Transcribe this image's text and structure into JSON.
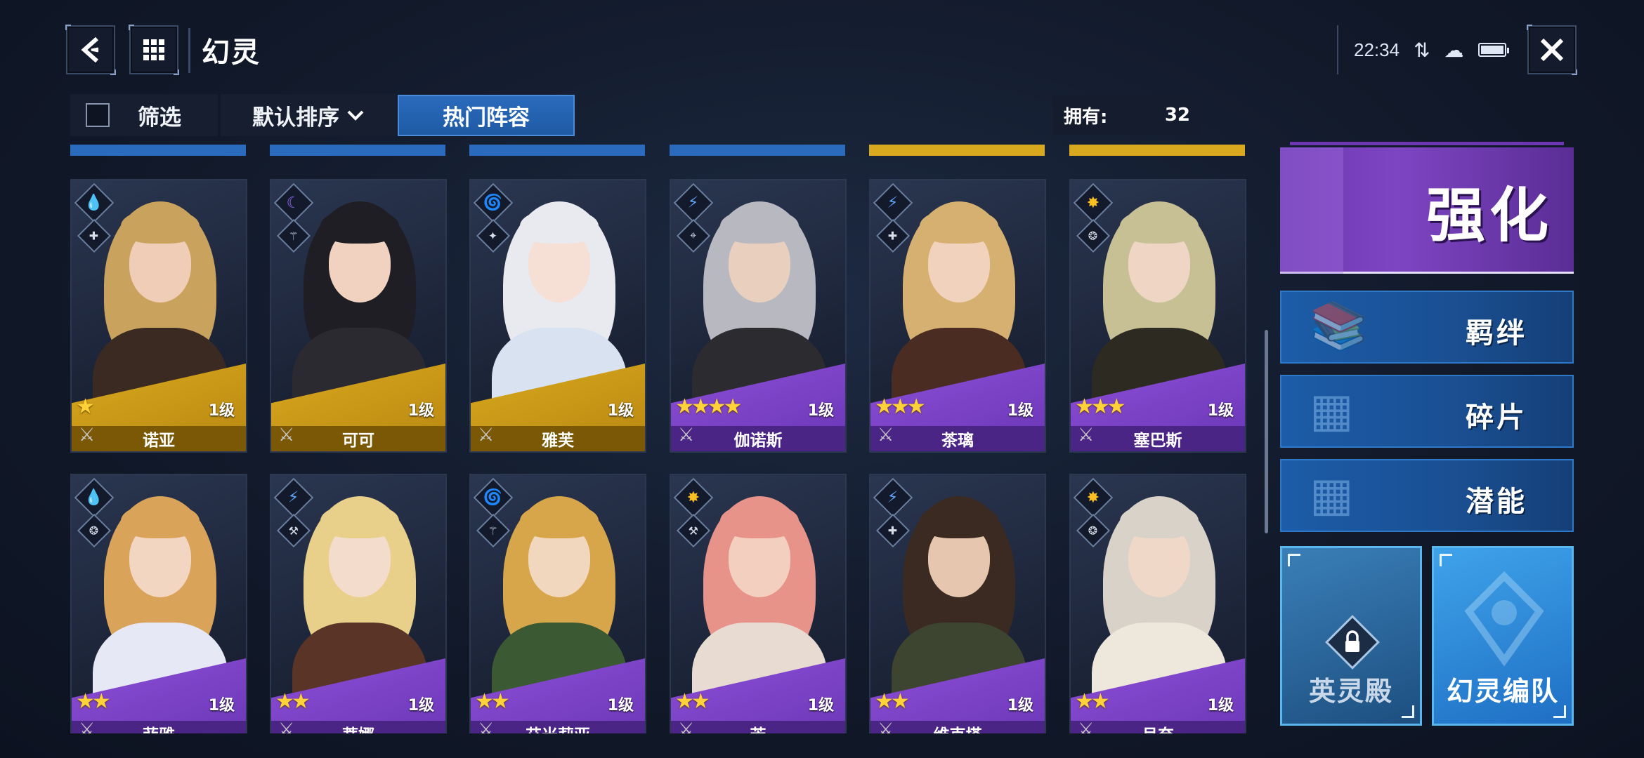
{
  "header": {
    "back_icon": "back-arrow-icon",
    "menu_icon": "grid-menu-icon",
    "title": "幻灵",
    "close_icon": "close-icon"
  },
  "status_bar": {
    "time": "22:34",
    "icons": [
      "data-transfer-icon",
      "weather-icon",
      "battery-icon"
    ]
  },
  "filter_bar": {
    "filter_label": "筛选",
    "filter_checked": false,
    "sort_label": "默认排序",
    "hot_label": "热门阵容",
    "owned_label": "拥有:",
    "owned_count": "32"
  },
  "rarity_colors": {
    "gold": "#d8a81e",
    "purple": "#7e45c2",
    "blue": "#2a6bbd"
  },
  "top_strip_colors": [
    "#2a6bbd",
    "#2a6bbd",
    "#2a6bbd",
    "#2a6bbd",
    "#d8a81e",
    "#d8a81e"
  ],
  "cards": [
    {
      "name": "诺亚",
      "level": "1级",
      "stars": 1,
      "rarity": "gold",
      "element": "water",
      "element_glyph": "💧",
      "element_color": "#4fc3f7",
      "role_glyph": "✚",
      "weapon_glyph": "⚔"
    },
    {
      "name": "可可",
      "level": "1级",
      "stars": 0,
      "rarity": "gold",
      "element": "moon",
      "element_glyph": "☾",
      "element_color": "#9b6bff",
      "role_glyph": "⚚",
      "weapon_glyph": "⚔"
    },
    {
      "name": "雅芙",
      "level": "1级",
      "stars": 0,
      "rarity": "gold",
      "element": "wind",
      "element_glyph": "🌀",
      "element_color": "#4ade80",
      "role_glyph": "✦",
      "weapon_glyph": "⚔"
    },
    {
      "name": "伽诺斯",
      "level": "1级",
      "stars": 4,
      "rarity": "purple",
      "element": "thunder",
      "element_glyph": "⚡",
      "element_color": "#60a5fa",
      "role_glyph": "⌖",
      "weapon_glyph": "⚔"
    },
    {
      "name": "茶璃",
      "level": "1级",
      "stars": 3,
      "rarity": "purple",
      "element": "thunder",
      "element_glyph": "⚡",
      "element_color": "#60a5fa",
      "role_glyph": "✚",
      "weapon_glyph": "⚔"
    },
    {
      "name": "塞巴斯",
      "level": "1级",
      "stars": 3,
      "rarity": "purple",
      "element": "light",
      "element_glyph": "✸",
      "element_color": "#fbbf24",
      "role_glyph": "❂",
      "weapon_glyph": "⚔"
    },
    {
      "name": "菲雅",
      "level": "1级",
      "stars": 2,
      "rarity": "purple",
      "element": "water",
      "element_glyph": "💧",
      "element_color": "#4fc3f7",
      "role_glyph": "❂",
      "weapon_glyph": "⚔"
    },
    {
      "name": "蒂娜",
      "level": "1级",
      "stars": 2,
      "rarity": "purple",
      "element": "thunder",
      "element_glyph": "⚡",
      "element_color": "#60a5fa",
      "role_glyph": "⚒",
      "weapon_glyph": "⚔"
    },
    {
      "name": "艾米莉亚",
      "level": "1级",
      "stars": 2,
      "rarity": "purple",
      "element": "wind",
      "element_glyph": "🌀",
      "element_color": "#4ade80",
      "role_glyph": "⚚",
      "weapon_glyph": "⚔"
    },
    {
      "name": "芳",
      "level": "1级",
      "stars": 2,
      "rarity": "purple",
      "element": "light",
      "element_glyph": "✸",
      "element_color": "#fbbf24",
      "role_glyph": "⚒",
      "weapon_glyph": "⚔"
    },
    {
      "name": "维克塔",
      "level": "1级",
      "stars": 2,
      "rarity": "purple",
      "element": "thunder",
      "element_glyph": "⚡",
      "element_color": "#60a5fa",
      "role_glyph": "✚",
      "weapon_glyph": "⚔"
    },
    {
      "name": "月奈",
      "level": "1级",
      "stars": 2,
      "rarity": "purple",
      "element": "light",
      "element_glyph": "✸",
      "element_color": "#fbbf24",
      "role_glyph": "❂",
      "weapon_glyph": "⚔"
    }
  ],
  "sidebar": {
    "enhance_label": "强化",
    "bond_label": "羁绊",
    "fragment_label": "碎片",
    "potential_label": "潜能",
    "hall_label": "英灵殿",
    "hall_locked": true,
    "team_label": "幻灵编队"
  }
}
